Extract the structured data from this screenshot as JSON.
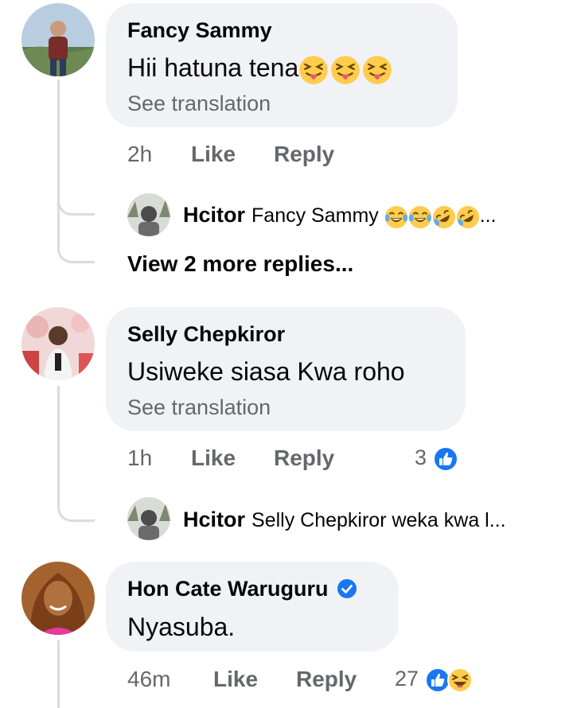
{
  "comments": [
    {
      "author": "Fancy Sammy",
      "text": "Hii hatuna tena",
      "emojis": [
        "squinting-tongue",
        "squinting-tongue",
        "squinting-tongue"
      ],
      "see_translation": "See translation",
      "time": "2h",
      "like": "Like",
      "reply": "Reply",
      "replies": [
        {
          "author": "Hcitor",
          "text": "Fancy Sammy",
          "emojis": [
            "tears-of-joy",
            "tears-of-joy",
            "rolling-laughing",
            "rolling-laughing"
          ],
          "ellipsis": "..."
        }
      ],
      "view_more": "View 2 more replies..."
    },
    {
      "author": "Selly Chepkiror",
      "text": "Usiweke siasa Kwa roho",
      "see_translation": "See translation",
      "time": "1h",
      "like": "Like",
      "reply": "Reply",
      "reaction_count": "3",
      "reactions": [
        "like"
      ],
      "replies": [
        {
          "author": "Hcitor",
          "text": "Selly Chepkiror weka kwa l..."
        }
      ]
    },
    {
      "author": "Hon Cate Waruguru",
      "verified": true,
      "text": "Nyasuba.",
      "time": "46m",
      "like": "Like",
      "reply": "Reply",
      "reaction_count": "27",
      "reactions": [
        "like",
        "haha"
      ]
    }
  ],
  "colors": {
    "bubble": "#f0f2f5",
    "secondary_text": "#65676b",
    "like_blue": "#1877f2",
    "emoji_yellow": "#ffcc4d"
  }
}
